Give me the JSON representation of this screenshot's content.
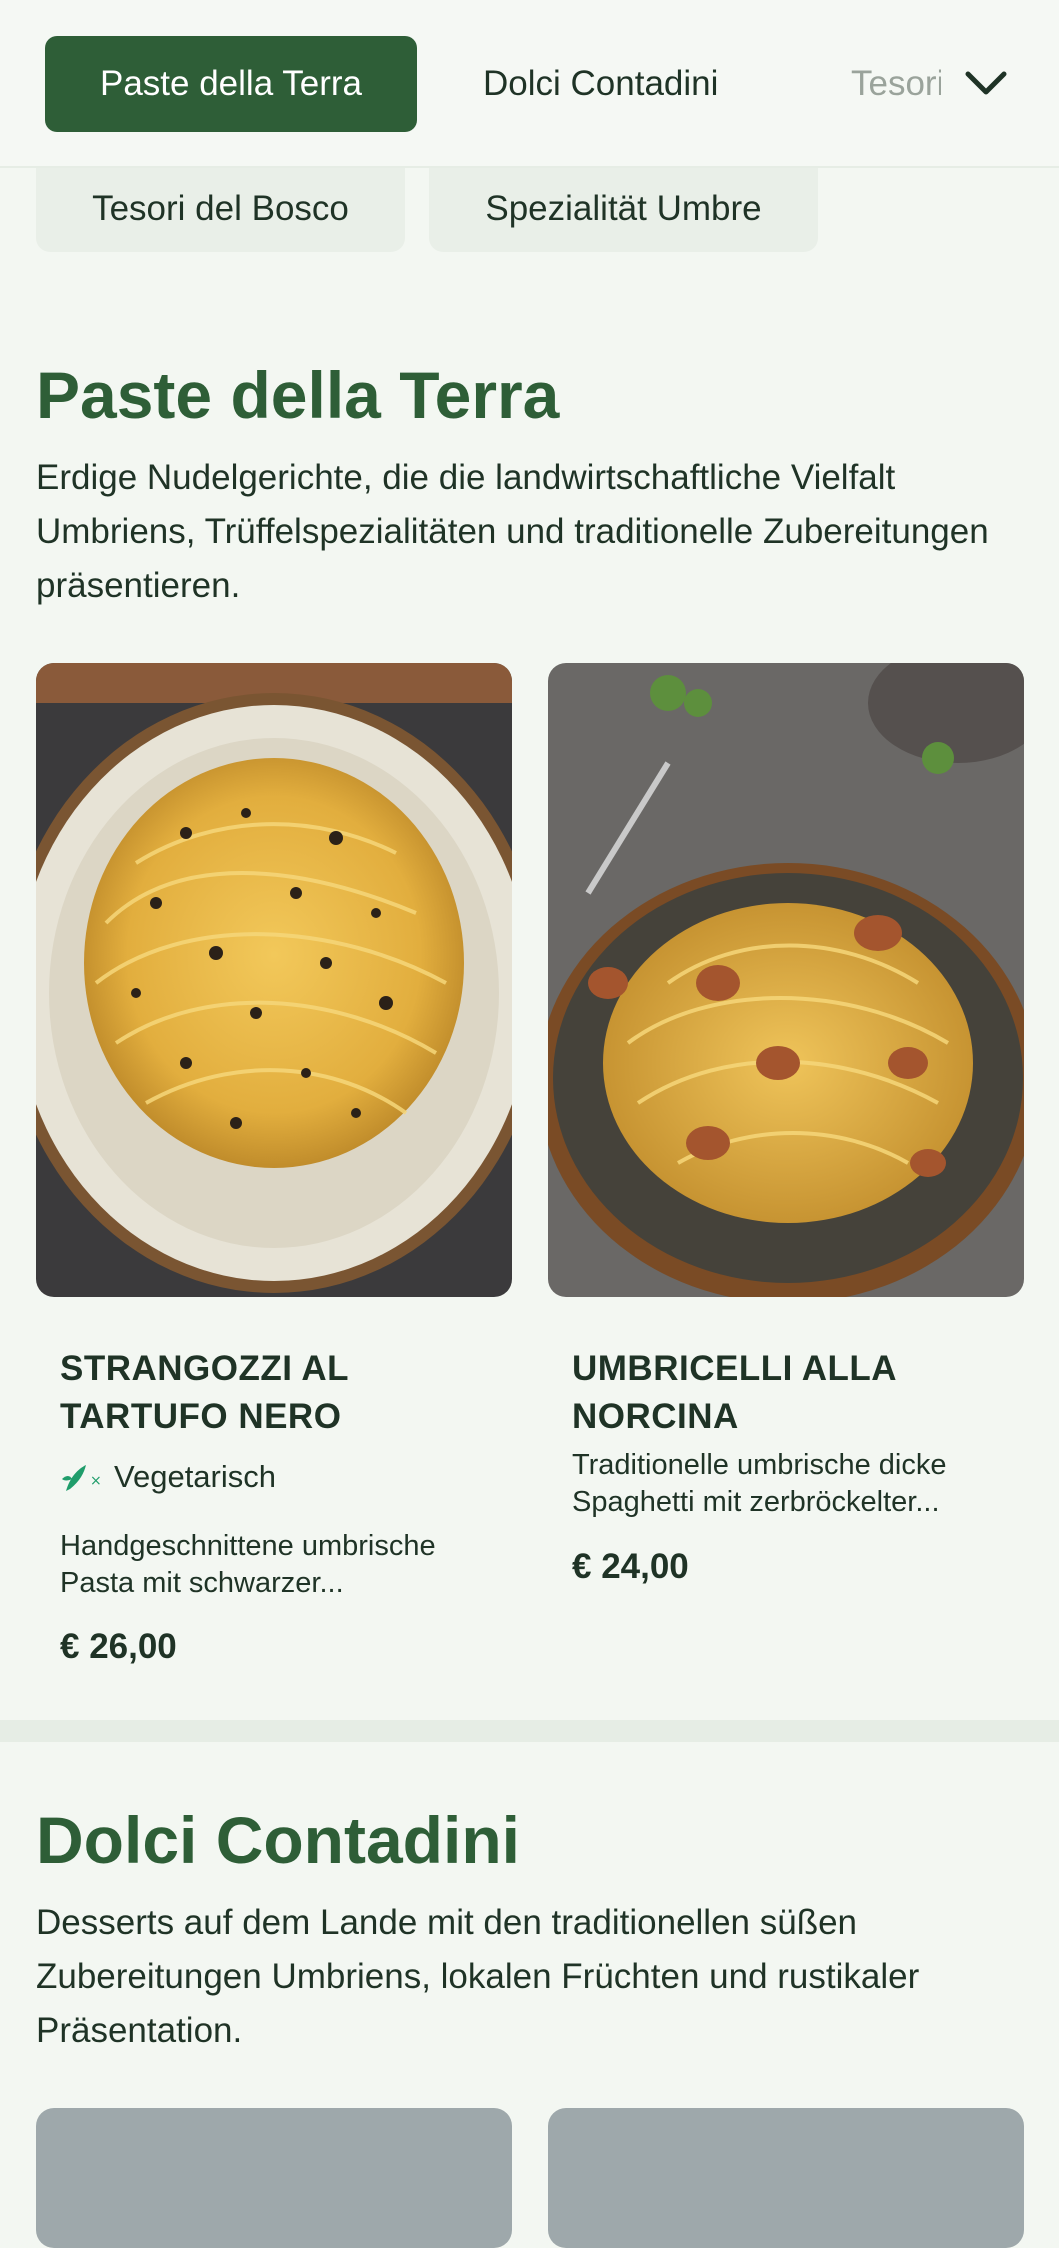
{
  "nav": {
    "tabs": [
      "Paste della Terra",
      "Dolci Contadini",
      "Tesori del Bosco"
    ],
    "chips": [
      "Tesori del Bosco",
      "Spezialität Umbre"
    ]
  },
  "sections": [
    {
      "title": "Paste della Terra",
      "description": "Erdige Nudelgerichte, die die landwirtschaftliche Vielfalt Umbriens, Trüffelspezialitäten und traditionelle Zubereitungen präsentieren.",
      "items": [
        {
          "name_line1": "STRANGOZZI AL",
          "name_line2": "TARTUFO NERO",
          "badge": "Vegetarisch",
          "desc_line1": "Handgeschnittene umbrische",
          "desc_line2": "Pasta mit schwarzer...",
          "price": "€ 26,00"
        },
        {
          "name_line1": "UMBRICELLI ALLA",
          "name_line2": "NORCINA",
          "desc_line1": "Traditionelle umbrische dicke",
          "desc_line2": "Spaghetti mit zerbröckelter...",
          "price": "€ 24,00"
        }
      ]
    },
    {
      "title": "Dolci Contadini",
      "description": "Desserts auf dem Lande mit den traditionellen süßen Zubereitungen Umbriens, lokalen Früchten und rustikaler Präsentation."
    }
  ],
  "colors": {
    "accent": "#2e5e37",
    "background": "#f3f7f2",
    "veg_icon": "#1f9d6b"
  },
  "icons": [
    "chevron-down-icon",
    "vegetarian-icon"
  ]
}
